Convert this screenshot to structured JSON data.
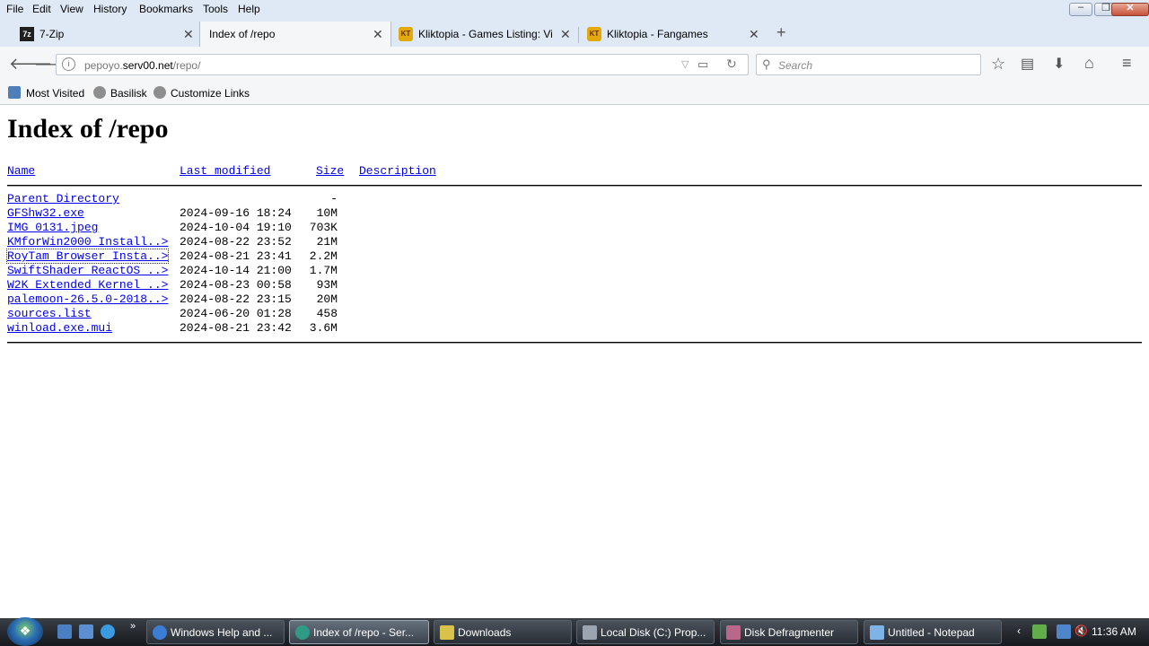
{
  "menu": {
    "items": [
      {
        "label": "File"
      },
      {
        "label": "Edit"
      },
      {
        "label": "View"
      },
      {
        "label": "History"
      },
      {
        "label": "Bookmarks"
      },
      {
        "label": "Tools"
      },
      {
        "label": "Help"
      }
    ]
  },
  "tabs": [
    {
      "title": "7-Zip",
      "active": false
    },
    {
      "title": "Index of /repo",
      "active": true
    },
    {
      "title": "Kliktopia - Games Listing: Vi",
      "active": false
    },
    {
      "title": "Kliktopia - Fangames",
      "active": false
    }
  ],
  "navbar": {
    "url_host_prefix": "pepoyo.",
    "url_host": "serv00.net",
    "url_path": "/repo/",
    "search_placeholder": "Search"
  },
  "bookmarks": [
    {
      "label": "Most Visited"
    },
    {
      "label": "Basilisk"
    },
    {
      "label": "Customize Links"
    }
  ],
  "page": {
    "heading": "Index of /repo",
    "columns": {
      "name": "Name",
      "modified": "Last modified",
      "size": "Size",
      "description": "Description"
    },
    "rows": [
      {
        "name": "Parent Directory",
        "modified": "",
        "size": "-"
      },
      {
        "name": "GFShw32.exe",
        "modified": "2024-09-16 18:24",
        "size": "10M"
      },
      {
        "name": "IMG_0131.jpeg",
        "modified": "2024-10-04 19:10",
        "size": "703K"
      },
      {
        "name": "KMforWin2000_Install..>",
        "modified": "2024-08-22 23:52",
        "size": "21M"
      },
      {
        "name": "RoyTam_Browser_Insta..>",
        "modified": "2024-08-21 23:41",
        "size": "2.2M"
      },
      {
        "name": "SwiftShader_ReactOS_..>",
        "modified": "2024-10-14 21:00",
        "size": "1.7M"
      },
      {
        "name": "W2K_Extended_Kernel_..>",
        "modified": "2024-08-23 00:58",
        "size": "93M"
      },
      {
        "name": "palemoon-26.5.0-2018..>",
        "modified": "2024-08-22 23:15",
        "size": "20M"
      },
      {
        "name": "sources.list",
        "modified": "2024-06-20 01:28",
        "size": "458"
      },
      {
        "name": "winload.exe.mui",
        "modified": "2024-08-21 23:42",
        "size": "3.6M"
      }
    ]
  },
  "taskbar": {
    "buttons": [
      {
        "label": "Windows Help and ...",
        "active": false
      },
      {
        "label": "Index of /repo - Ser...",
        "active": true
      },
      {
        "label": "Downloads",
        "active": false
      },
      {
        "label": "Local Disk (C:) Prop...",
        "active": false
      },
      {
        "label": "Disk Defragmenter",
        "active": false
      },
      {
        "label": "Untitled - Notepad",
        "active": false
      }
    ],
    "clock": "11:36 AM"
  },
  "colors": {
    "link": "#0000ee",
    "chrome": "#dfe9f5",
    "toolbar": "#f5f6f7"
  }
}
